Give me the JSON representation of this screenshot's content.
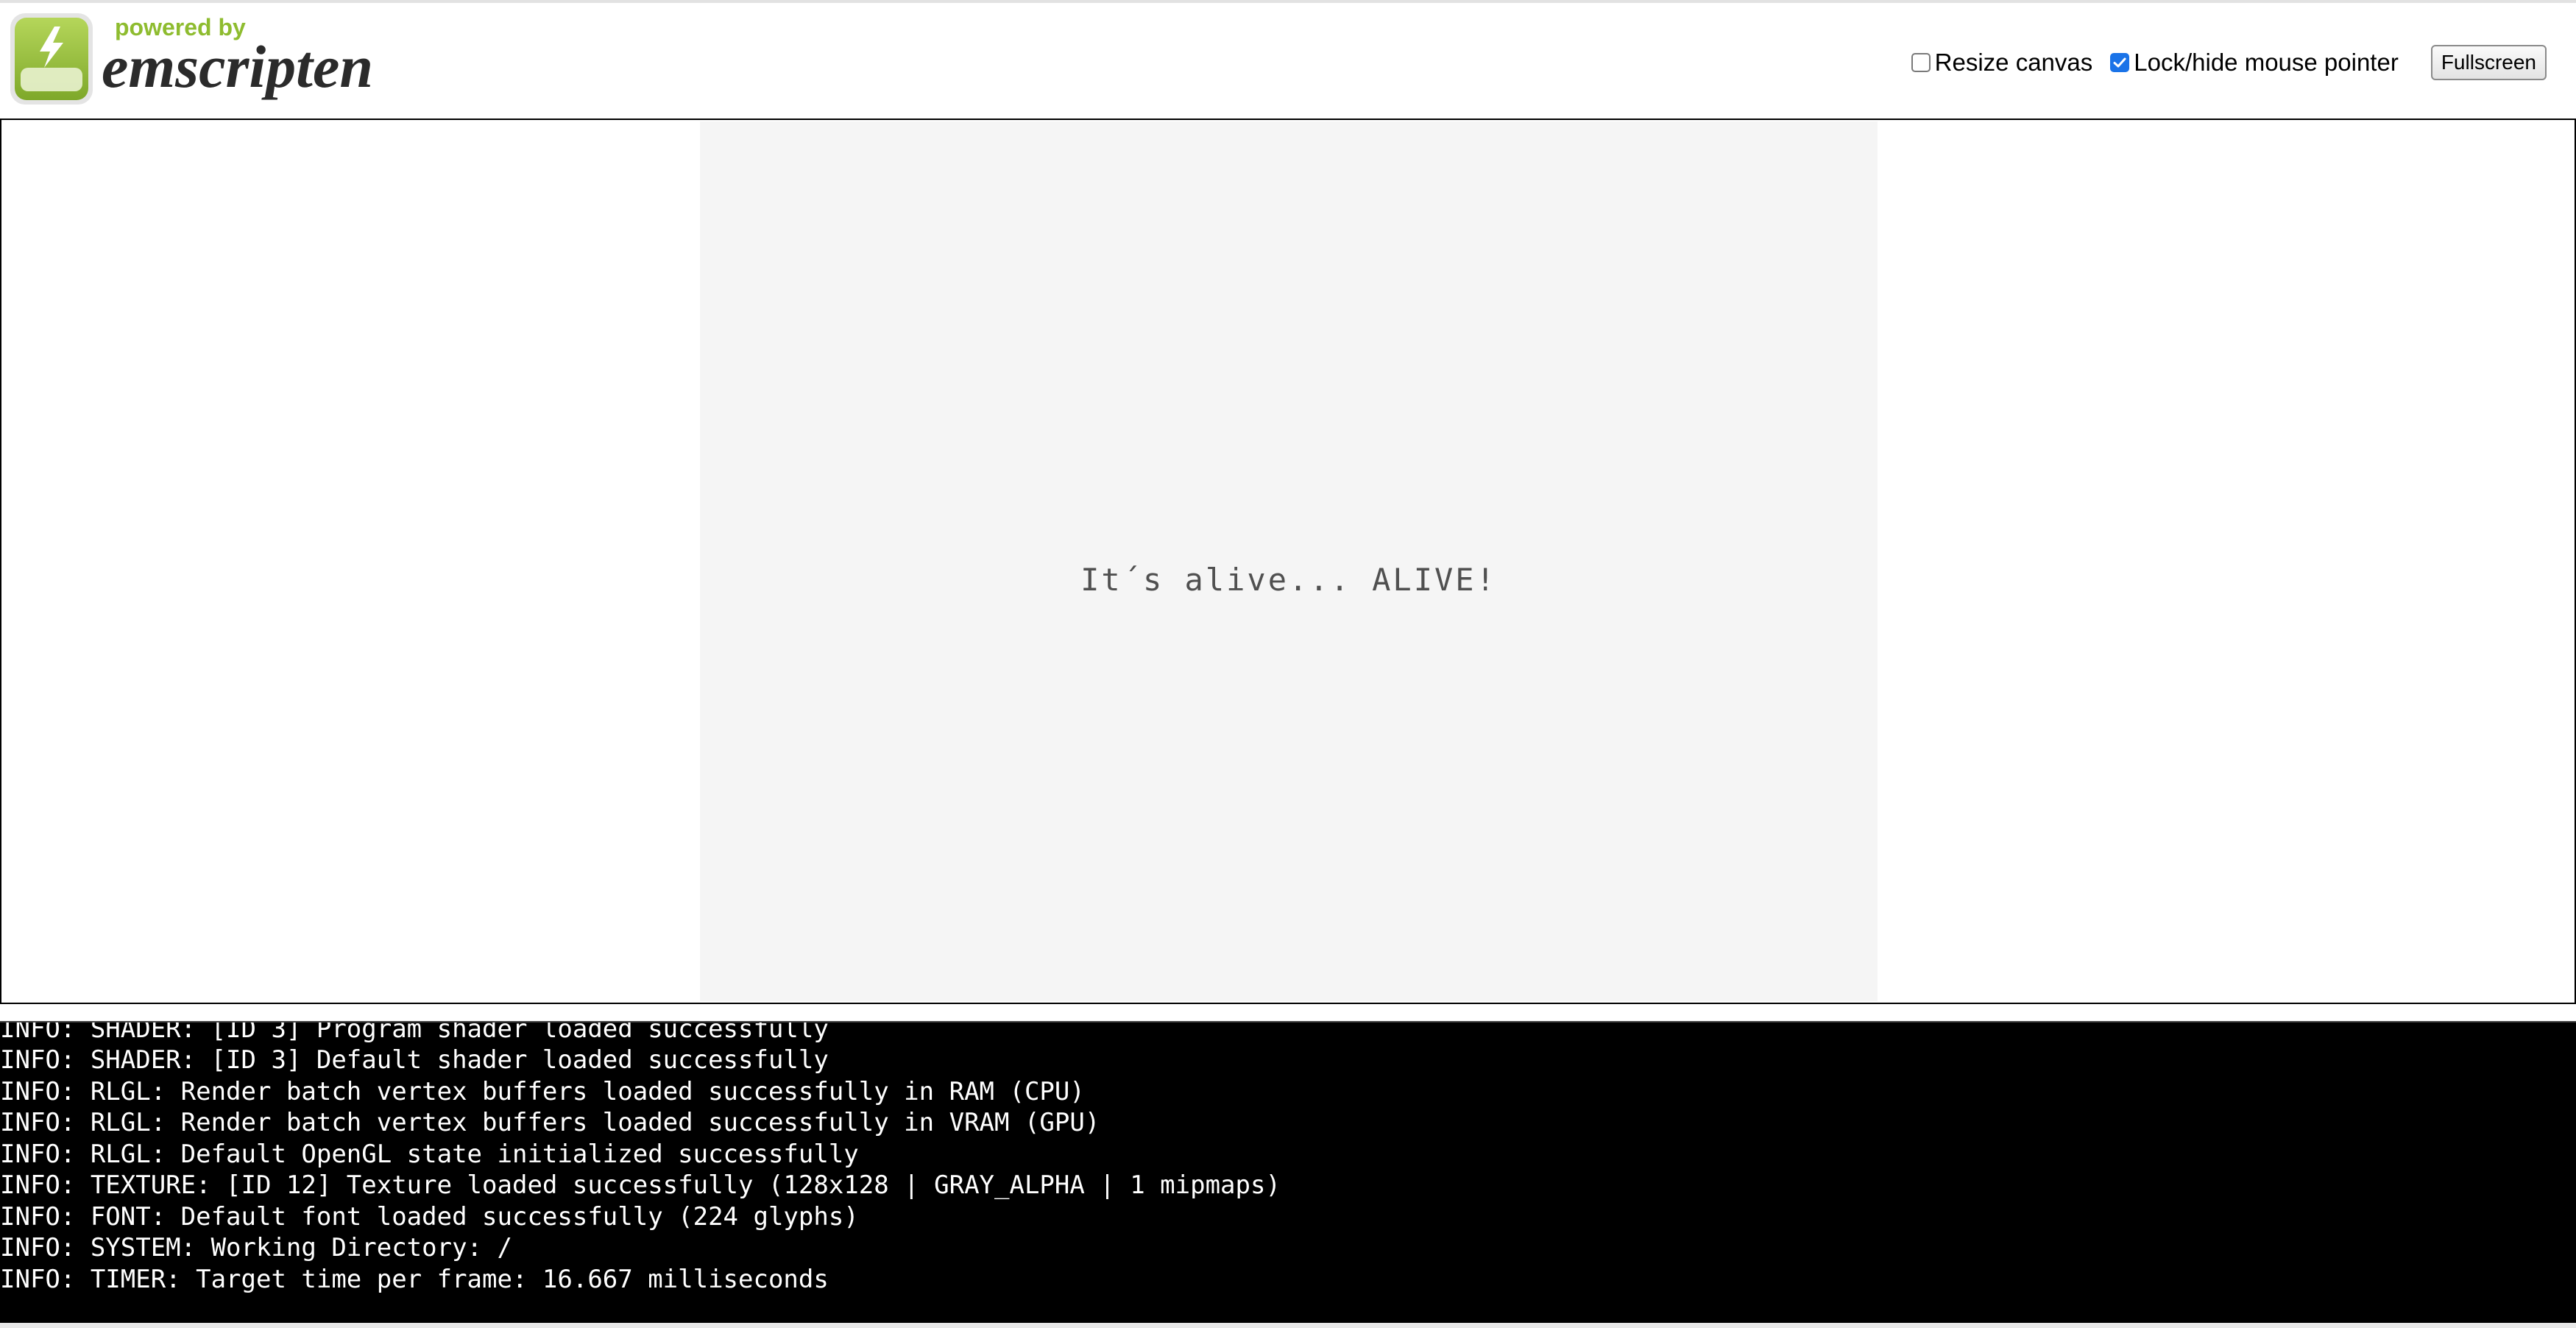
{
  "header": {
    "logo": {
      "tagline": "powered by",
      "wordmark": "emscripten",
      "icon": "lightning-bolt-icon"
    },
    "controls": {
      "resize_canvas": {
        "label": "Resize canvas",
        "checked": false
      },
      "lock_pointer": {
        "label": "Lock/hide mouse pointer",
        "checked": true
      },
      "fullscreen_label": "Fullscreen"
    }
  },
  "canvas": {
    "message": "It´s alive... ALIVE!"
  },
  "console": {
    "lines": [
      "INFO: SHADER: [ID 3] Program shader loaded successfully",
      "INFO: SHADER: [ID 3] Default shader loaded successfully",
      "INFO: RLGL: Render batch vertex buffers loaded successfully in RAM (CPU)",
      "INFO: RLGL: Render batch vertex buffers loaded successfully in VRAM (GPU)",
      "INFO: RLGL: Default OpenGL state initialized successfully",
      "INFO: TEXTURE: [ID 12] Texture loaded successfully (128x128 | GRAY_ALPHA | 1 mipmaps)",
      "INFO: FONT: Default font loaded successfully (224 glyphs)",
      "INFO: SYSTEM: Working Directory: /",
      "INFO: TIMER: Target time per frame: 16.667 milliseconds"
    ]
  },
  "colors": {
    "logo_green": "#8ebc2f",
    "checkbox_accent": "#1a73e8",
    "console_bg": "#000000",
    "canvas_bg": "#f5f5f5"
  }
}
